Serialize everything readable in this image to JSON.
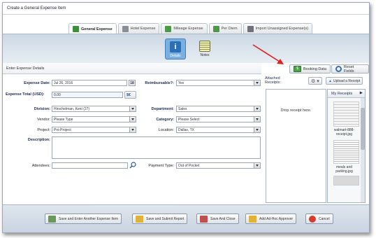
{
  "window": {
    "title": "Create a General Expense Item"
  },
  "tabs": [
    {
      "label": "General Expense",
      "icon": "dollar-icon"
    },
    {
      "label": "Hotel Expense",
      "icon": "hotel-icon"
    },
    {
      "label": "Mileage Expense",
      "icon": "car-icon"
    },
    {
      "label": "Per Diem",
      "icon": "per-diem-icon"
    },
    {
      "label": "Import Unassigned Expense(s)",
      "icon": "import-icon"
    }
  ],
  "subtabs": {
    "details": "Details",
    "notes": "Notes"
  },
  "section": {
    "title": "Enter Expense Details",
    "booking": "Booking Data",
    "reset": "Reset Fields"
  },
  "form": {
    "expense_date_label": "Expense Date:",
    "expense_date": "Jul 26, 2016",
    "cal": "18",
    "reimbursable_label": "Reimbursable?:",
    "reimbursable": "Yes",
    "total_label": "Expense Total (USD):",
    "total": "0.00",
    "division_label": "Division:",
    "division": "Hirschelman, Kent (27)",
    "department_label": "Department:",
    "department": "Sales",
    "vendor_label": "Vendor:",
    "vendor": "Please Type",
    "category_label": "Category:",
    "category": "Please Select",
    "project_label": "Project:",
    "project": "Pro Project",
    "location_label": "Location:",
    "location": "Dallas, TX",
    "description_label": "Description:",
    "attendees_label": "Attendees:",
    "payment_label": "Payment Type:",
    "payment": "Out of Pocket"
  },
  "receipts": {
    "attached": "Attached Receipts:",
    "upload": "Upload a Receipt",
    "drop": "Drop receipt here.",
    "my": "My Receipts",
    "file1": "walmart-888-receipt.jpg",
    "file2": "meals and parking.jpg"
  },
  "footer": [
    "Save and Enter Another Expense Item",
    "Save and Submit Report",
    "Save And Close",
    "Add Ad-Hoc Approver",
    "Cancel"
  ]
}
